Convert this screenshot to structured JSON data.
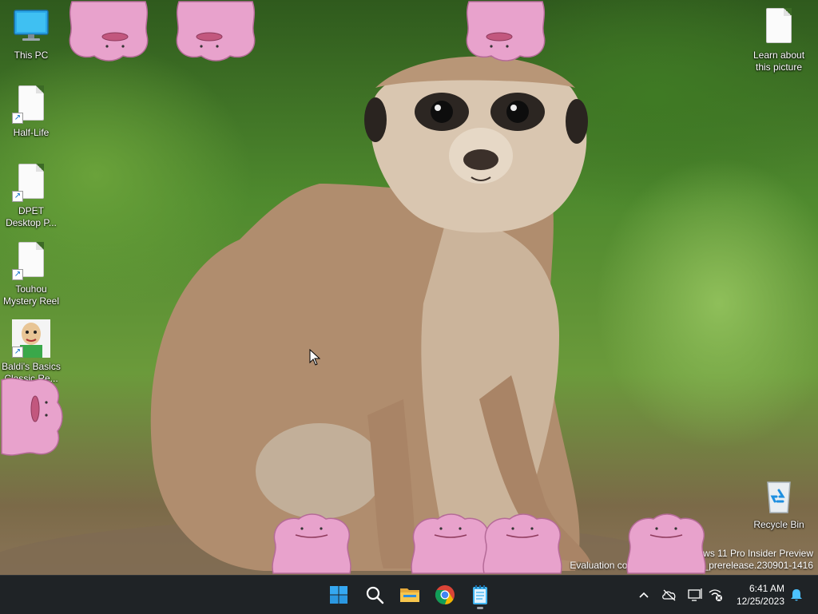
{
  "desktop": {
    "icons": [
      {
        "label": "This PC",
        "icon": "monitor-icon"
      },
      {
        "label": "Half-Life",
        "icon": "file-shortcut-icon"
      },
      {
        "label": "DPET Desktop P...",
        "icon": "file-shortcut-icon"
      },
      {
        "label": "Touhou Mystery Reel",
        "icon": "file-shortcut-icon"
      },
      {
        "label": "Baldi's Basics Classic Re...",
        "icon": "baldi-shortcut-icon"
      },
      {
        "label": "Learn about this picture",
        "icon": "file-icon"
      },
      {
        "label": "Recycle Bin",
        "icon": "recycle-bin-icon"
      }
    ],
    "pets": {
      "name": "ditto",
      "count": 9
    }
  },
  "watermark": {
    "line1": "Windows 11 Pro Insider Preview",
    "line2": "Evaluation copy. Build 25967.rs_prerelease.230901-1416"
  },
  "taskbar": {
    "apps": [
      {
        "name": "Start",
        "icon": "windows-start-icon"
      },
      {
        "name": "Search",
        "icon": "search-icon"
      },
      {
        "name": "File Explorer",
        "icon": "folder-icon"
      },
      {
        "name": "Google Chrome",
        "icon": "chrome-icon"
      },
      {
        "name": "Notepad",
        "icon": "notepad-icon"
      }
    ],
    "tray": {
      "icons": [
        "chevron-up-icon",
        "onedrive-offline-icon",
        "display-icon",
        "network-disconnected-icon",
        "notification-bell-icon"
      ],
      "time": "6:41 AM",
      "date": "12/25/2023"
    },
    "accent": "#0078d4"
  }
}
